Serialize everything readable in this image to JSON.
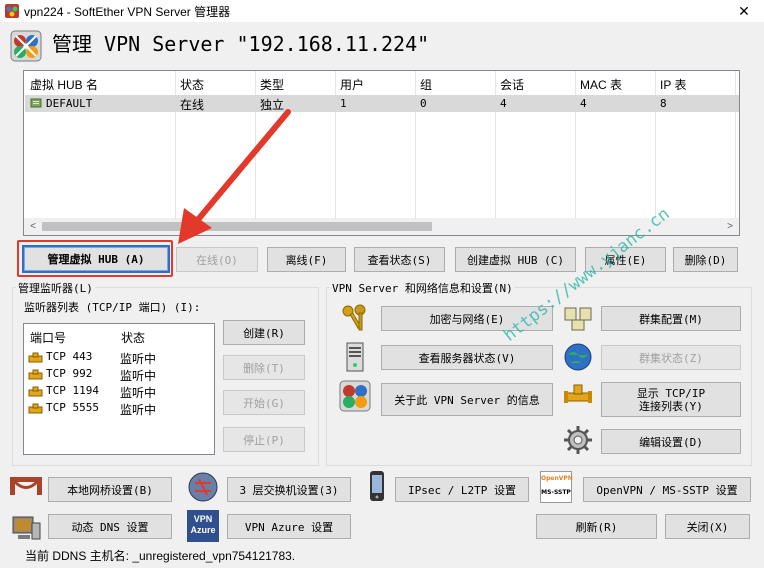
{
  "window": {
    "title": "vpn224 - SoftEther VPN Server 管理器",
    "close_label": "✕"
  },
  "header": {
    "title": "管理 VPN Server \"192.168.11.224\""
  },
  "hub_table": {
    "columns": [
      "虚拟 HUB 名",
      "状态",
      "类型",
      "用户",
      "组",
      "会话",
      "MAC 表",
      "IP 表"
    ],
    "rows": [
      {
        "name": "DEFAULT",
        "status": "在线",
        "type": "独立",
        "users": "1",
        "groups": "0",
        "sessions": "4",
        "mac": "4",
        "ip": "8"
      }
    ],
    "scroll_left": "<",
    "scroll_right": ">"
  },
  "hub_buttons": {
    "manage": "管理虚拟 HUB (A)",
    "online": "在线(O)",
    "offline": "离线(F)",
    "status": "查看状态(S)",
    "create": "创建虚拟 HUB (C)",
    "properties": "属性(E)",
    "delete": "删除(D)"
  },
  "listener": {
    "group_label": "管理监听器(L)",
    "list_label": "监听器列表 (TCP/IP 端口) (I):",
    "columns": [
      "端口号",
      "状态"
    ],
    "rows": [
      {
        "port": "TCP 443",
        "state": "监听中"
      },
      {
        "port": "TCP 992",
        "state": "监听中"
      },
      {
        "port": "TCP 1194",
        "state": "监听中"
      },
      {
        "port": "TCP 5555",
        "state": "监听中"
      }
    ],
    "create": "创建(R)",
    "delete": "删除(T)",
    "start": "开始(G)",
    "stop": "停止(P)"
  },
  "server_info": {
    "group_label": "VPN Server 和网络信息和设置(N)",
    "encryption": "加密与网络(E)",
    "server_status": "查看服务器状态(V)",
    "about": "关于此 VPN Server 的信息",
    "cluster_config": "群集配置(M)",
    "cluster_status": "群集状态(Z)",
    "show_tcp": "显示 TCP/IP\n连接列表(Y)",
    "edit_config": "编辑设置(D)"
  },
  "bottom_buttons": {
    "local_bridge": "本地网桥设置(B)",
    "layer3": "3 层交换机设置(3)",
    "ipsec": "IPsec / L2TP 设置",
    "openvpn": "OpenVPN / MS-SSTP 设置",
    "ddns": "动态 DNS 设置",
    "azure": "VPN Azure 设置",
    "refresh": "刷新(R)",
    "close": "关闭(X)"
  },
  "icon_labels": {
    "openvpn_top": "OpenVPN",
    "openvpn_bottom": "MS-SSTP",
    "azure_top": "VPN",
    "azure_bottom": "Azure"
  },
  "status_bar": {
    "ddns_text": "当前 DDNS 主机名: _unregistered_vpn754121783."
  },
  "watermark": "https://www.yjanc.cn",
  "colors": {
    "highlight_box": "#e2392b",
    "arrow": "#e2392b",
    "selected_row": "#d9d9d9",
    "watermark": "#20b5a5"
  }
}
